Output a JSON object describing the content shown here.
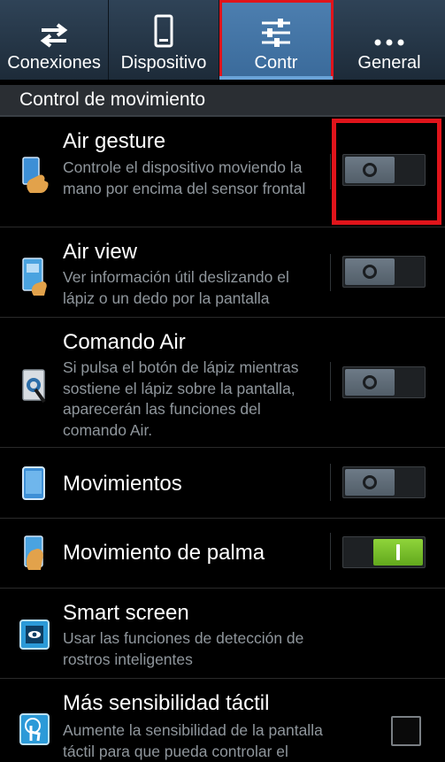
{
  "tabs": [
    {
      "label": "Conexiones",
      "icon": "swap-arrows-icon"
    },
    {
      "label": "Dispositivo",
      "icon": "phone-icon"
    },
    {
      "label": "Contr",
      "icon": "sliders-icon",
      "active": true
    },
    {
      "label": "General",
      "icon": "more-dots-icon"
    }
  ],
  "section": {
    "title": "Control de movimiento"
  },
  "rows": [
    {
      "title": "Air gesture",
      "desc": "Controle el dispositivo moviendo la mano por encima del sensor frontal",
      "state": "off"
    },
    {
      "title": "Air view",
      "desc": "Ver información útil deslizando el lápiz o un dedo por la pantalla",
      "state": "off"
    },
    {
      "title": "Comando Air",
      "desc": "Si pulsa el botón de lápiz mientras sostiene el lápiz sobre la pantalla, aparecerán las funciones del comando Air.",
      "state": "off"
    },
    {
      "title": "Movimientos",
      "state": "off"
    },
    {
      "title": "Movimiento de palma",
      "state": "on"
    },
    {
      "title": "Smart screen",
      "desc": "Usar las funciones de detección de rostros inteligentes"
    },
    {
      "title": "Más sensibilidad táctil",
      "desc": "Aumente la sensibilidad de la pantalla táctil para que pueda controlar el",
      "state": "unchecked"
    }
  ],
  "colors": {
    "accent": "#3a6a9a",
    "highlight": "#e0141b",
    "toggle_on": "#7cc22b"
  }
}
